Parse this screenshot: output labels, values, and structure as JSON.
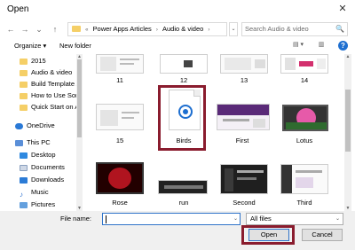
{
  "window": {
    "title": "Open",
    "close_glyph": "✕"
  },
  "address": {
    "back": "←",
    "forward": "→",
    "dropdown": "⌄",
    "up": "↑",
    "overflow": "«",
    "crumbs": [
      "Power Apps Articles",
      "Audio & video"
    ],
    "separator": "›",
    "search_placeholder": "Search Audio & video",
    "search_icon": "🔍"
  },
  "commandbar": {
    "organize": "Organize ▾",
    "new_folder": "New folder",
    "view_icon": "▤ ▾",
    "pane_icon": "▥",
    "help": "?"
  },
  "nav": {
    "items": [
      {
        "label": "2015",
        "icon": "folder"
      },
      {
        "label": "Audio & video",
        "icon": "folder"
      },
      {
        "label": "Build Template A",
        "icon": "folder"
      },
      {
        "label": "How to Use Sort",
        "icon": "folder"
      },
      {
        "label": "Quick Start on A",
        "icon": "folder"
      },
      {
        "label": "OneDrive",
        "icon": "cloud"
      },
      {
        "label": "This PC",
        "icon": "pc"
      },
      {
        "label": "Desktop",
        "icon": "desktop"
      },
      {
        "label": "Documents",
        "icon": "docs"
      },
      {
        "label": "Downloads",
        "icon": "dl"
      },
      {
        "label": "Music",
        "icon": "music",
        "glyph": "♪"
      },
      {
        "label": "Pictures",
        "icon": "pics"
      }
    ]
  },
  "files": {
    "row1": [
      "11",
      "12",
      "13",
      "14"
    ],
    "row2": [
      "15",
      "Birds",
      "First",
      "Lotus"
    ],
    "row3": [
      "Rose",
      "run",
      "Second",
      "Third"
    ]
  },
  "bottom": {
    "file_name_label": "File name:",
    "file_name_value": "",
    "filter": "All files",
    "open": "Open",
    "cancel": "Cancel",
    "dropdown_glyph": "⌄"
  },
  "colors": {
    "highlight": "#8a1c2e",
    "accent": "#2f73c9",
    "folder": "#f5cf67"
  }
}
